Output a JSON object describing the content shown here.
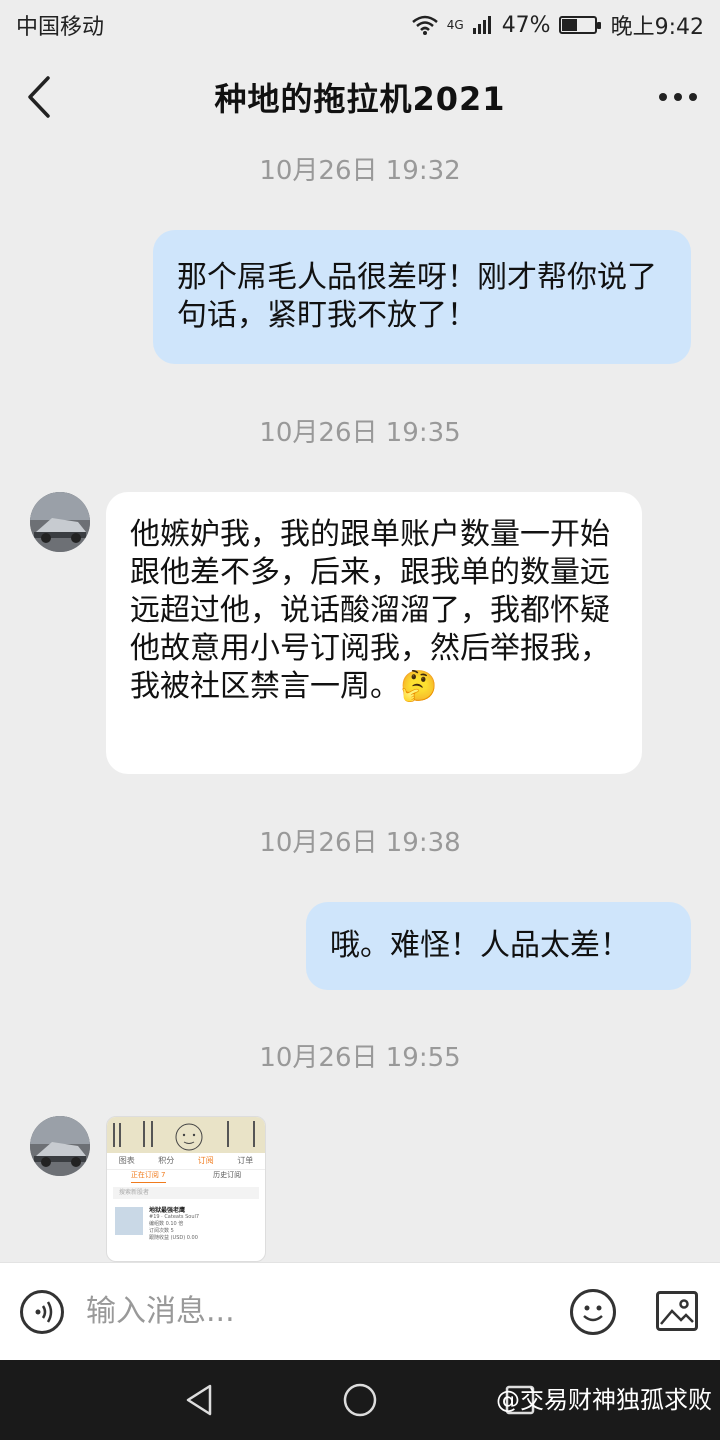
{
  "status": {
    "carrier": "中国移动",
    "network": "4G",
    "battery_pct": "47%",
    "battery_level": 0.47,
    "time": "晚上9:42"
  },
  "header": {
    "title": "种地的拖拉机2021"
  },
  "messages": [
    {
      "timestamp": "10月26日 19:32",
      "sender": "me",
      "text": "那个屌毛人品很差呀！刚才帮你说了句话，紧盯我不放了！"
    },
    {
      "timestamp": "10月26日 19:35",
      "sender": "them",
      "text": "他嫉妒我，我的跟单账户数量一开始跟他差不多，后来，跟我单的数量远远超过他，说话酸溜溜了，我都怀疑他故意用小号订阅我，然后举报我，我被社区禁言一周。🤔"
    },
    {
      "timestamp": "10月26日 19:38",
      "sender": "me",
      "text": "哦。难怪！人品太差！"
    },
    {
      "timestamp": "10月26日 19:55",
      "sender": "them",
      "type": "image"
    }
  ],
  "image_message": {
    "tabs": [
      "图表",
      "积分",
      "订阅",
      "订单"
    ],
    "subtabs": [
      "正在订阅 7",
      "历史订阅"
    ],
    "search_placeholder": "搜索新股者",
    "item_name": "地狱最强老鹰",
    "item_line1": "#19 · Cateats Soul7",
    "item_line2": "编组数 0.10 倍",
    "item_line3": "订阅次数 5",
    "item_line4": "跟随收益 (USD) 0.00"
  },
  "input": {
    "placeholder": "输入消息..."
  },
  "watermark": "@交易财神独孤求败"
}
